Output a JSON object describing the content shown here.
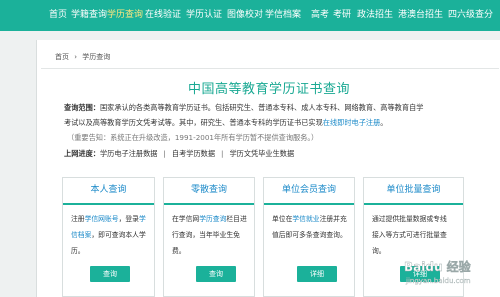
{
  "nav": {
    "items": [
      "首页",
      "学籍查询",
      "学历查询",
      "在线验证",
      "学历认证",
      "图像校对",
      "学信档案",
      "高考",
      "考研",
      "政法招生",
      "港澳台招生",
      "四六级查分"
    ],
    "active_index": 2
  },
  "breadcrumb": {
    "home": "首页",
    "arrow": "›",
    "current": "学历查询"
  },
  "title": "中国高等教育学历证书查询",
  "scope": {
    "label": "查询范围：",
    "line1": "国家承认的各类高等教育学历证书。包括研究生、普通本专科、成人本专科、网络教育、高等教育自学",
    "line2a": "考试以及高等教育学历文凭考试等。其中，研究生、普通本专科的学历证书已实现",
    "line2_link": "在线即时电子注册",
    "line2b": "。",
    "note": "（重要告知：系统正在升级改造，1991-2001年所有学历暂不提供查询服务。）"
  },
  "progress": {
    "label": "上网进度：",
    "items": [
      "学历电子注册数据",
      "自考学历数据",
      "学历文凭毕业生数据"
    ],
    "separator": "|"
  },
  "cards": [
    {
      "title": "本人查询",
      "body": [
        "注册",
        "学信网账号",
        "，登录",
        "学信档案",
        "，即可查询本人学历。"
      ],
      "button": "查询"
    },
    {
      "title": "零散查询",
      "body": [
        "在学信网",
        "学历查询",
        "栏目进行查询，当年毕业生免费。"
      ],
      "button": "查询"
    },
    {
      "title": "单位会员查询",
      "body": [
        "单位在",
        "学信就业",
        "注册并充值后即可多条查询查询。"
      ],
      "button": "详细"
    },
    {
      "title": "单位批量查询",
      "body": [
        "通过提供批量数据或专线接入等方式可进行批量查询。"
      ],
      "button": "详细"
    }
  ],
  "watermark": {
    "text": "Baidu 经验",
    "sub": "jingyan.baidu.com"
  },
  "colors": {
    "nav": "#1bb19a",
    "title": "#1aa993",
    "link": "#1a89c8"
  }
}
